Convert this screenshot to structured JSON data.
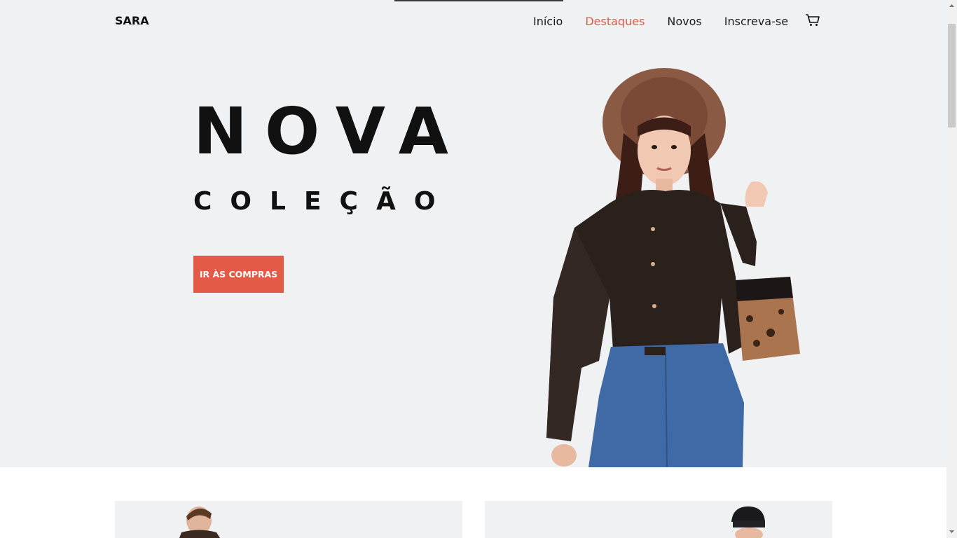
{
  "nav": {
    "brand": "SARA",
    "items": [
      {
        "label": "Início",
        "active": false
      },
      {
        "label": "Destaques",
        "active": true
      },
      {
        "label": "Novos",
        "active": false
      },
      {
        "label": "Inscreva-se",
        "active": false
      }
    ],
    "cart_icon": "cart-icon"
  },
  "hero": {
    "title": "NOVA",
    "subtitle": "COLEÇÃO",
    "cta_label": "IR ÀS COMPRAS",
    "image": "model-photo"
  },
  "colors": {
    "accent": "#e35a46",
    "hero_bg": "#f0f1f3",
    "text": "#111111"
  },
  "cards": [
    {
      "image": "man-photo"
    },
    {
      "image": "person-beanie-photo"
    }
  ]
}
